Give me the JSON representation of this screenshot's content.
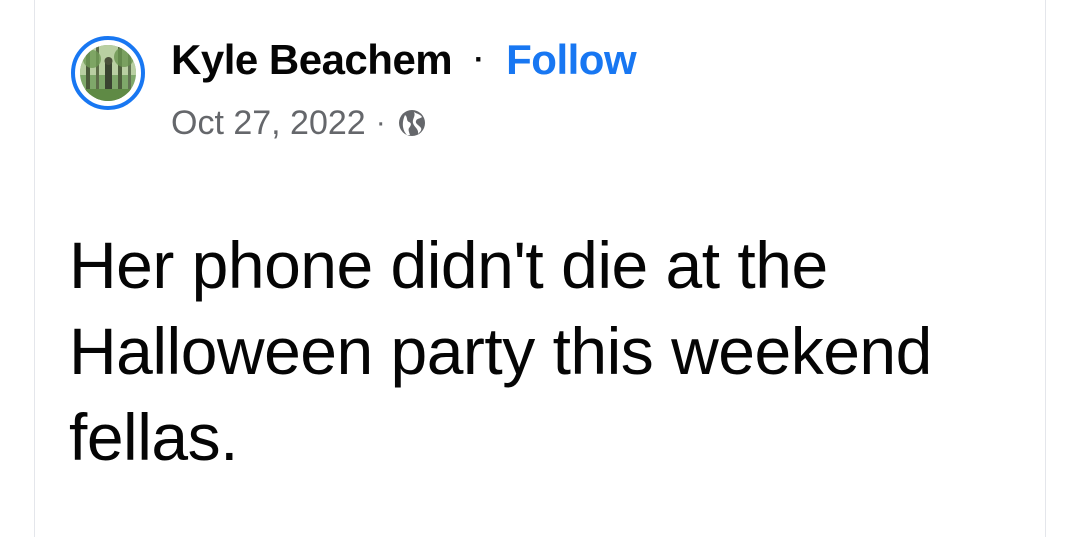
{
  "post": {
    "author": "Kyle Beachem",
    "separator": "·",
    "follow_label": "Follow",
    "date": "Oct 27, 2022",
    "meta_separator": "·",
    "audience_icon": "globe-icon",
    "avatar_icon": "profile-photo-forest",
    "text": "Her phone didn't die at the Halloween party this weekend fellas."
  },
  "colors": {
    "accent": "#1877f2",
    "primary_text": "#050505",
    "secondary_text": "#65676b",
    "background": "#ffffff"
  }
}
